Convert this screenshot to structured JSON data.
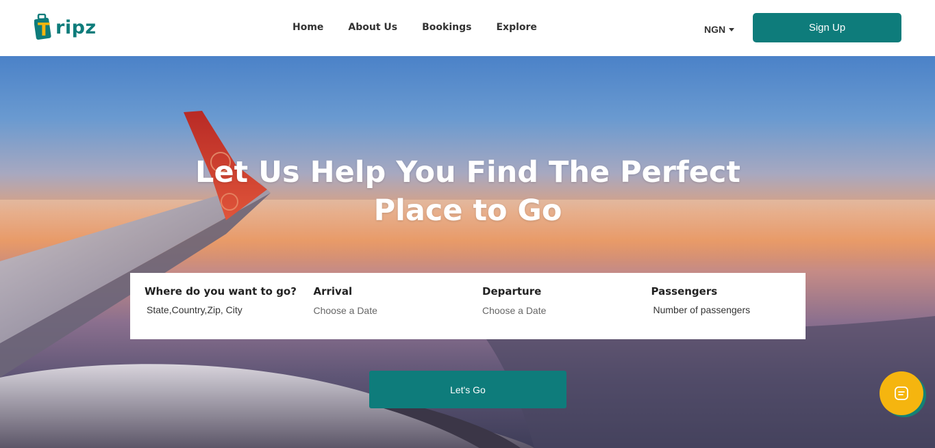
{
  "brand": {
    "name": "ripz",
    "logo_letter": "T",
    "colors": {
      "primary": "#0e7c7b",
      "accent": "#f5b50f"
    }
  },
  "nav": {
    "items": [
      {
        "label": "Home"
      },
      {
        "label": "About Us"
      },
      {
        "label": "Bookings"
      },
      {
        "label": "Explore"
      }
    ]
  },
  "header": {
    "currency": "NGN",
    "signup_label": "Sign Up"
  },
  "hero": {
    "title": "Let Us Help You Find The Perfect Place to Go"
  },
  "search": {
    "fields": [
      {
        "label": "Where do you want to go?",
        "placeholder": "State,Country,Zip, City"
      },
      {
        "label": "Arrival",
        "placeholder": "Choose a Date"
      },
      {
        "label": "Departure",
        "placeholder": "Choose a Date"
      },
      {
        "label": "Passengers",
        "placeholder": "Number of passengers"
      }
    ],
    "submit_label": "Let's Go"
  },
  "chat": {
    "icon": "chat-icon"
  }
}
